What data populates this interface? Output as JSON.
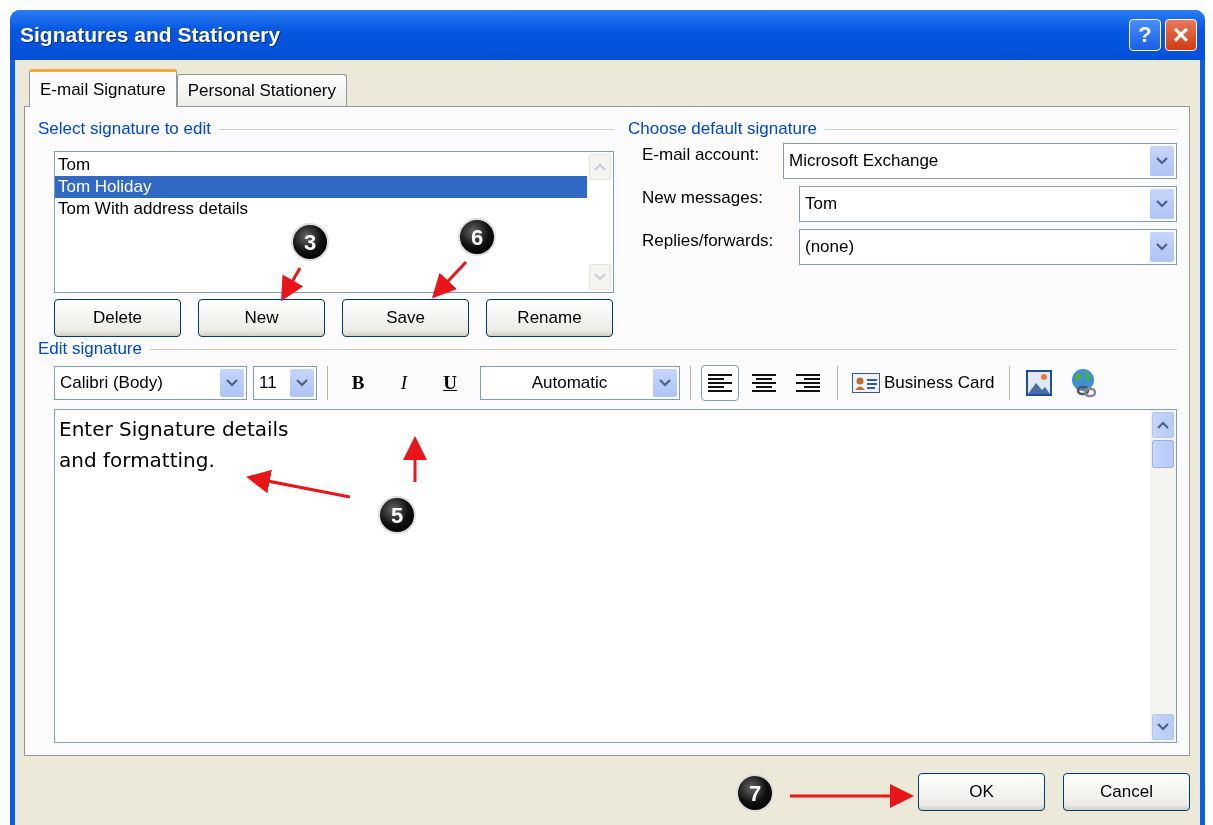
{
  "window": {
    "title": "Signatures and Stationery",
    "buttons": [
      {
        "kind": "help",
        "label": "?"
      },
      {
        "kind": "close",
        "label": "×"
      }
    ]
  },
  "tabs": [
    {
      "label": "E-mail Signature",
      "selected": true
    },
    {
      "label": "Personal Stationery",
      "selected": false
    }
  ],
  "select_signature": {
    "heading": "Select signature to edit",
    "items": [
      {
        "label": "Tom",
        "selected": false
      },
      {
        "label": "Tom Holiday",
        "selected": true
      },
      {
        "label": "Tom With address details",
        "selected": false
      }
    ],
    "buttons": [
      "Delete",
      "New",
      "Save",
      "Rename"
    ]
  },
  "default_signature": {
    "heading": "Choose default signature",
    "fields": [
      {
        "label": "E-mail account:",
        "value": "Microsoft Exchange"
      },
      {
        "label": "New messages:",
        "value": "Tom"
      },
      {
        "label": "Replies/forwards:",
        "value": "(none)"
      }
    ]
  },
  "edit_signature": {
    "heading": "Edit signature",
    "toolbar": {
      "font": "Calibri (Body)",
      "size": "11",
      "bold": "B",
      "italic": "I",
      "underline": "U",
      "font_color_picker": "Automatic",
      "align": [
        {
          "kind": "left",
          "selected": true
        },
        {
          "kind": "center",
          "selected": false
        },
        {
          "kind": "right",
          "selected": false
        }
      ],
      "business_card": "Business Card"
    },
    "lines": [
      "Enter Signature details",
      "and formatting."
    ]
  },
  "buttons": [
    "OK",
    "Cancel"
  ],
  "callouts": [
    {
      "label": "3"
    },
    {
      "label": "6"
    },
    {
      "label": "5"
    },
    {
      "label": "7"
    }
  ]
}
